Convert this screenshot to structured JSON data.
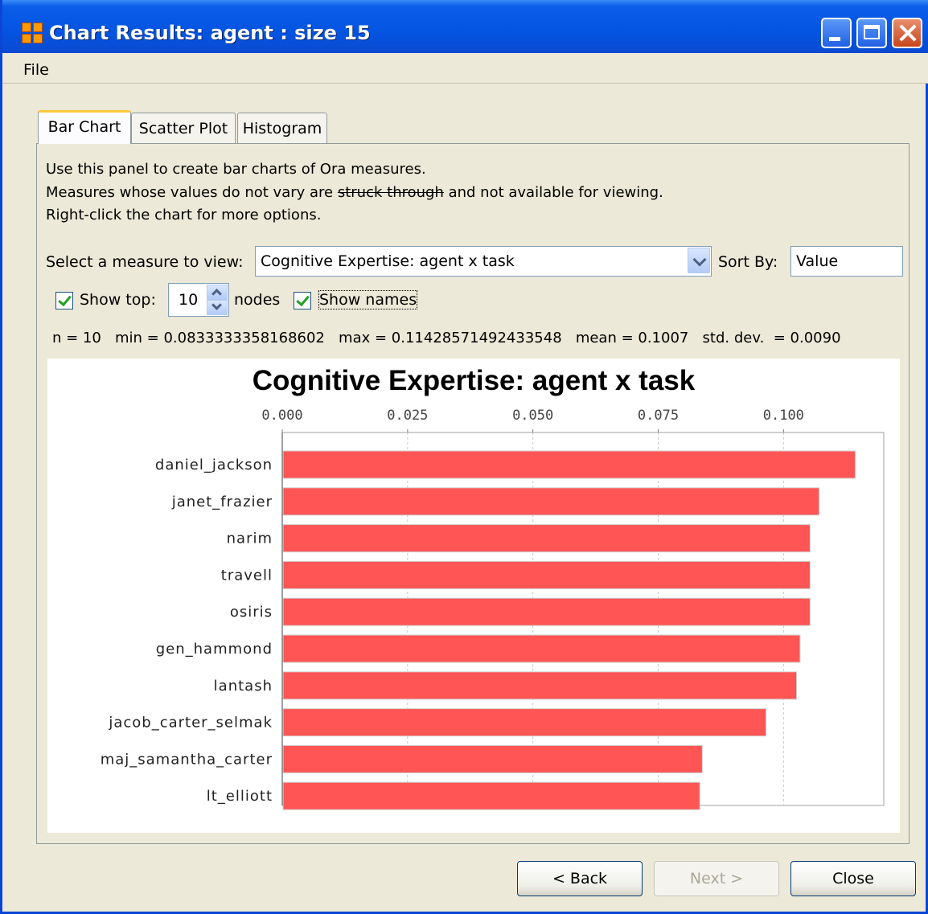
{
  "window": {
    "title": "Chart Results: agent : size 15"
  },
  "menu": {
    "file": "File"
  },
  "tabs": [
    {
      "label": "Bar Chart",
      "active": true
    },
    {
      "label": "Scatter Plot",
      "active": false
    },
    {
      "label": "Histogram",
      "active": false
    }
  ],
  "description": {
    "line1": "Use this panel to create bar charts of Ora measures.",
    "line2_before": "Measures whose values do not vary are ",
    "line2_struck": "struck through",
    "line2_after": " and not available for viewing.",
    "line3": "Right-click the chart for more options."
  },
  "controls": {
    "measure_label": "Select a measure to view:",
    "measure_value": "Cognitive Expertise: agent x task",
    "sort_label": "Sort By:",
    "sort_value": "Value",
    "show_top_label": "Show top:",
    "show_top_value": "10",
    "nodes_label": "nodes",
    "show_names_label": "Show names",
    "show_top_checked": true,
    "show_names_checked": true
  },
  "stats": {
    "text": "n = 10   min = 0.0833333358168602   max = 0.11428571492433548   mean = 0.1007   std. dev.  = 0.0090"
  },
  "buttons": {
    "back": "< Back",
    "next": "Next >",
    "close": "Close"
  },
  "colors": {
    "bar": "#ff5555",
    "title_bar": "#0454e2",
    "tab_highlight": "#ffc83c"
  },
  "chart_data": {
    "type": "bar",
    "orientation": "horizontal",
    "title": "Cognitive Expertise: agent x task",
    "categories": [
      "daniel_jackson",
      "janet_frazier",
      "narim",
      "travell",
      "osiris",
      "gen_hammond",
      "lantash",
      "jacob_carter_selmak",
      "maj_samantha_carter",
      "lt_elliott"
    ],
    "values": [
      0.1143,
      0.1071,
      0.1053,
      0.1053,
      0.1053,
      0.1033,
      0.1026,
      0.0965,
      0.0838,
      0.0833
    ],
    "ticks": [
      "0.000",
      "0.025",
      "0.050",
      "0.075",
      "0.100"
    ],
    "xlim": [
      0,
      0.12
    ],
    "grid": true
  }
}
